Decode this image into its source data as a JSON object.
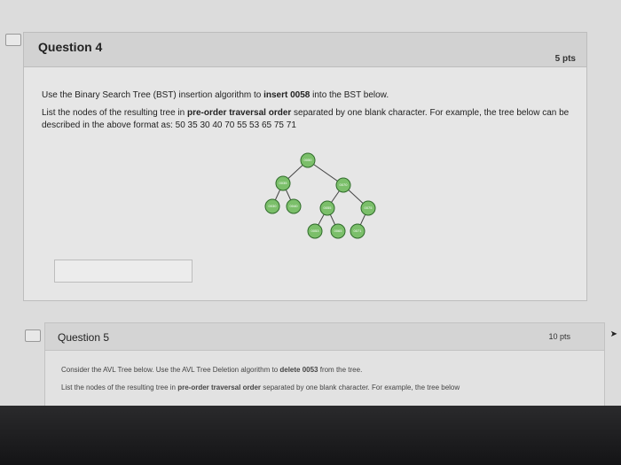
{
  "question4": {
    "title": "Question 4",
    "points": "5 pts",
    "instruction_prefix": "Use the Binary Search Tree (BST) insertion algorithm to ",
    "instruction_bold": "insert 0058",
    "instruction_suffix": " into the BST below.",
    "list_prefix": "List the nodes of the resulting tree in ",
    "list_bold": "pre-order traversal order",
    "list_suffix": " separated by one blank character. For example, the tree below can be described in the above format as: 50 35 30 40 70 55 53 65 75 71",
    "tree_nodes": [
      "0050",
      "0035",
      "0070",
      "0030",
      "0040",
      "0055",
      "0075",
      "0053",
      "0065",
      "0071"
    ],
    "answer_value": ""
  },
  "question5": {
    "title": "Question 5",
    "points": "10 pts",
    "instruction_prefix": "Consider the AVL Tree below. Use the AVL Tree Deletion algorithm to ",
    "instruction_bold": "delete 0053",
    "instruction_suffix": " from the tree.",
    "list_prefix": "List the nodes of the resulting tree in ",
    "list_bold": "pre-order traversal order",
    "list_suffix": " separated by one blank character. For example, the tree below"
  },
  "icons": {
    "flag": "flag-icon",
    "cursor": "mouse-pointer-icon"
  }
}
